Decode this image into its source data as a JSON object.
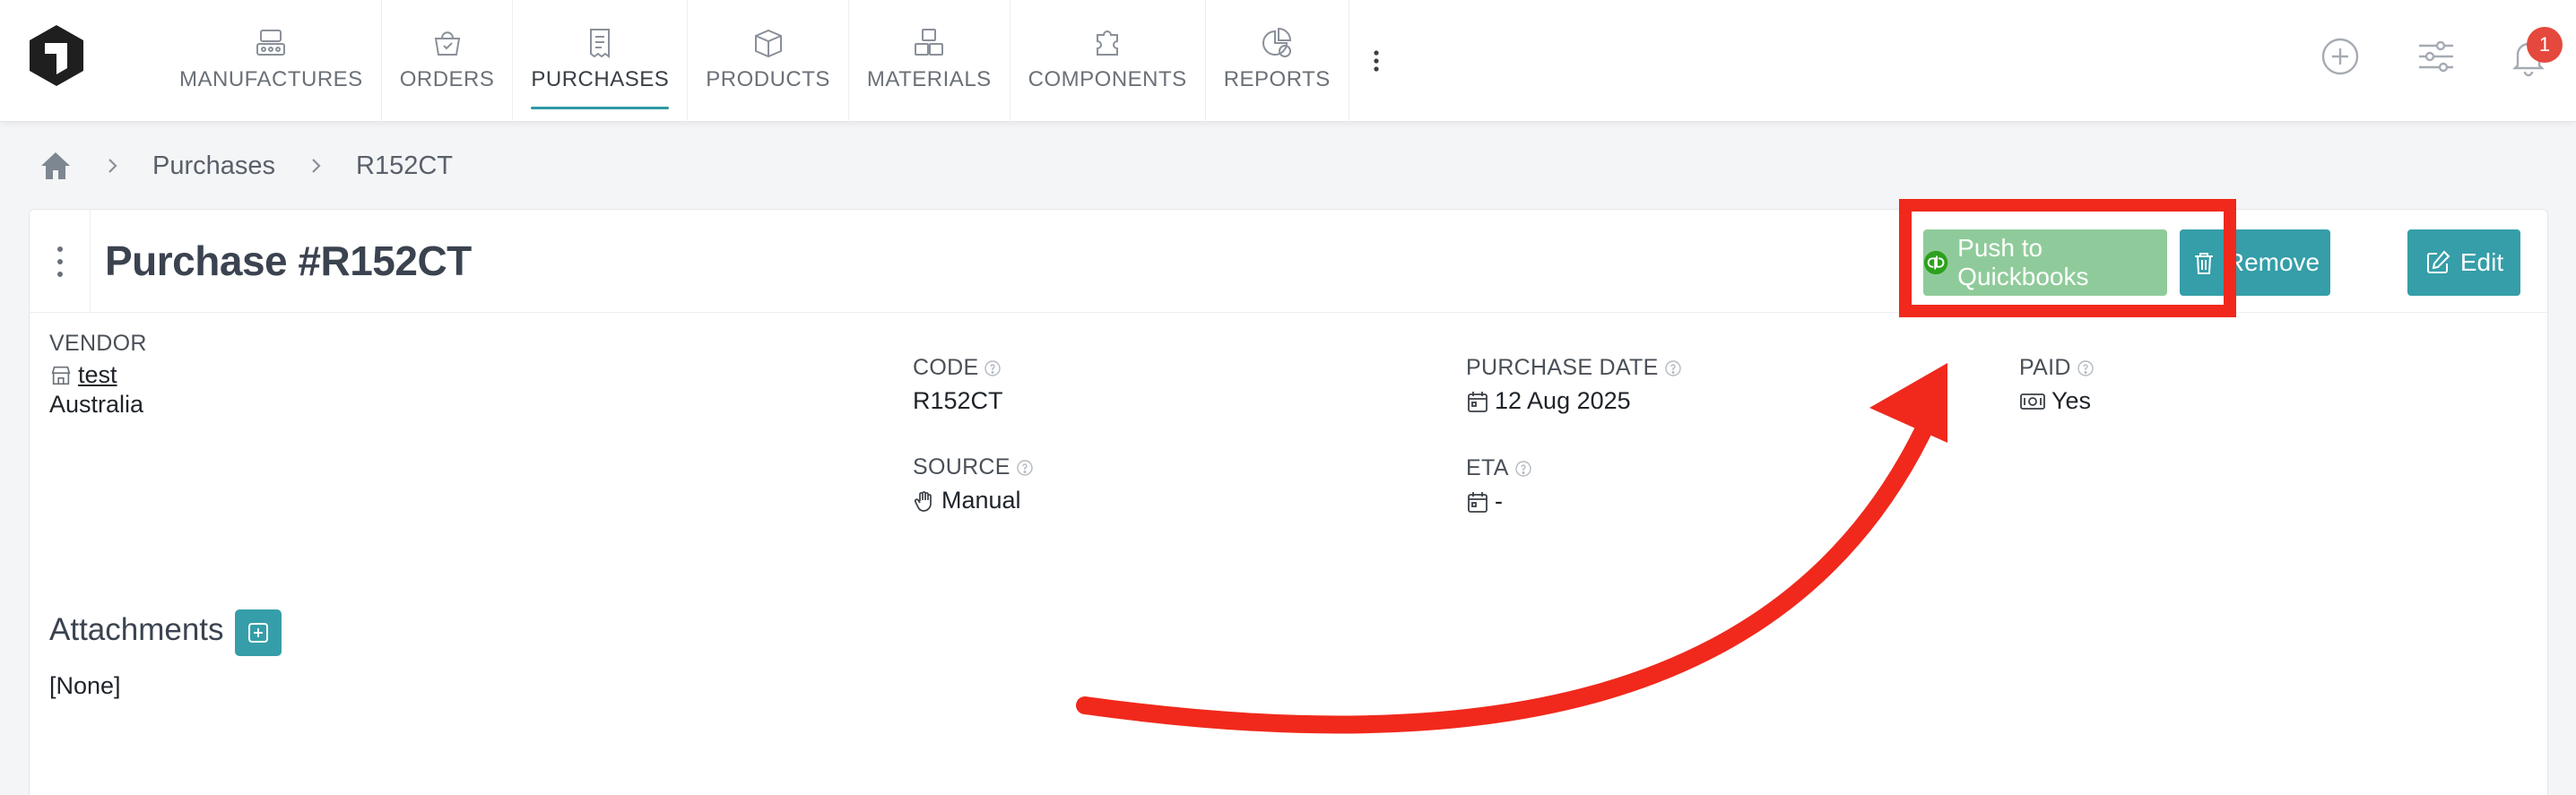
{
  "nav": {
    "items": [
      {
        "label": "MANUFACTURES",
        "icon": "factory-icon"
      },
      {
        "label": "ORDERS",
        "icon": "basket-icon"
      },
      {
        "label": "PURCHASES",
        "icon": "receipt-icon",
        "active": true
      },
      {
        "label": "PRODUCTS",
        "icon": "box-icon"
      },
      {
        "label": "MATERIALS",
        "icon": "blocks-icon"
      },
      {
        "label": "COMPONENTS",
        "icon": "puzzle-icon"
      },
      {
        "label": "REPORTS",
        "icon": "chart-icon"
      }
    ],
    "more_icon": "more-vertical-icon"
  },
  "top_actions": {
    "add_icon": "plus-circle-icon",
    "filters_icon": "sliders-icon",
    "notifications_icon": "bell-icon",
    "notification_count": "1"
  },
  "breadcrumb": {
    "home_icon": "home-icon",
    "items": [
      "Purchases",
      "R152CT"
    ]
  },
  "purchase": {
    "title": "Purchase #R152CT",
    "buttons": {
      "push_quickbooks": "Push to Quickbooks",
      "remove": "Remove",
      "edit": "Edit"
    },
    "vendor": {
      "label": "VENDOR",
      "name": "test",
      "country": "Australia"
    },
    "code": {
      "label": "CODE",
      "value": "R152CT"
    },
    "purchase_date": {
      "label": "PURCHASE DATE",
      "value": "12 Aug 2025"
    },
    "paid": {
      "label": "PAID",
      "value": "Yes"
    },
    "source": {
      "label": "SOURCE",
      "value": "Manual"
    },
    "eta": {
      "label": "ETA",
      "value": "-"
    }
  },
  "attachments": {
    "title": "Attachments",
    "empty_text": "[None]"
  },
  "colors": {
    "accent": "#359ea8",
    "quickbooks_button": "#8fcb9a",
    "annotation_red": "#f0291c",
    "badge_red": "#e5483d"
  }
}
